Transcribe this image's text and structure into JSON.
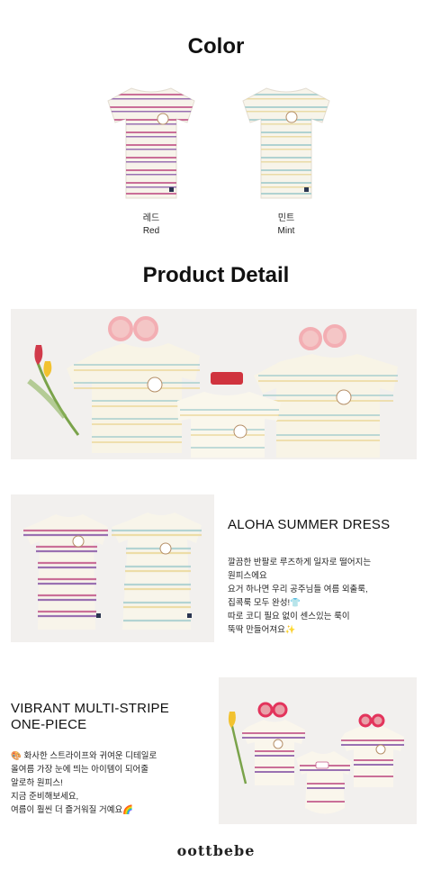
{
  "color_section": {
    "heading": "Color",
    "swatches": [
      {
        "name_ko": "레드",
        "name_en": "Red",
        "stripe_color": "#c2588a"
      },
      {
        "name_ko": "민트",
        "name_en": "Mint",
        "stripe_color": "#a8cfcf"
      }
    ]
  },
  "detail_section": {
    "heading": "Product Detail"
  },
  "feature_1": {
    "title": "ALOHA SUMMER DRESS",
    "description": "깔끔한 반팔로 루즈하게 일자로 떨어지는\n원피스에요\n요거 하나면 우리 공주님들 여름 외출룩,\n집콕룩 모두 완성!👕\n따로 코디 필요 없이 센스있는 룩이\n뚝딱 만들어져요✨"
  },
  "feature_2": {
    "title": "VIBRANT MULTI-STRIPE\nONE-PIECE",
    "description": "🎨 화사한 스트라이프와 귀여운 디테일로\n올여름 가장 눈에 띄는 아이템이 되어줄\n알로하 원피스!\n지금 준비해보세요,\n여름이 훨씬 더 즐거워질 거예요🌈"
  },
  "brand": {
    "logo": "oottbebe"
  }
}
